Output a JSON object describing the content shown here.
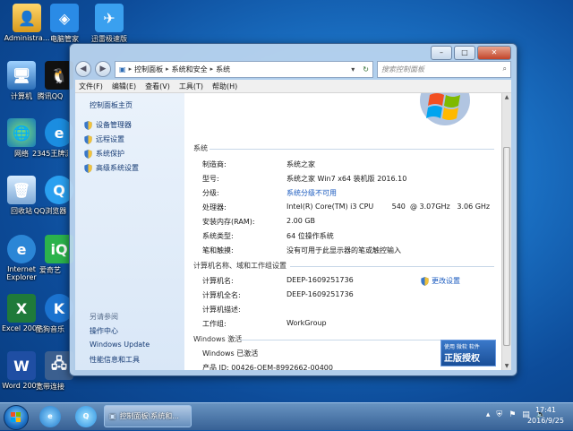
{
  "desktop": {
    "icons": [
      {
        "label": "Administra...",
        "icon": "user-folder-icon"
      },
      {
        "label": "电脑管家",
        "icon": "shield-icon"
      },
      {
        "label": "迅雷极速版",
        "icon": "bird-icon"
      },
      {
        "label": "计算机",
        "icon": "computer-icon"
      },
      {
        "label": "腾讯QQ",
        "icon": "qq-penguin-icon"
      },
      {
        "label": "网络",
        "icon": "network-globe-icon"
      },
      {
        "label": "2345王牌浏览器",
        "icon": "browser-e-icon"
      },
      {
        "label": "回收站",
        "icon": "recycle-bin-icon"
      },
      {
        "label": "QQ浏览器",
        "icon": "qq-browser-icon"
      },
      {
        "label": "Internet Explorer",
        "icon": "ie-icon"
      },
      {
        "label": "爱奇艺",
        "icon": "iqiyi-icon"
      },
      {
        "label": "Excel 2007",
        "icon": "excel-icon"
      },
      {
        "label": "酷狗音乐",
        "icon": "kugou-icon"
      },
      {
        "label": "Word 2007",
        "icon": "word-icon"
      },
      {
        "label": "宽带连接",
        "icon": "broadband-icon"
      }
    ]
  },
  "window": {
    "controls": {
      "minimize": "–",
      "maximize": "□",
      "close": "✕"
    },
    "breadcrumb": [
      "控制面板",
      "系统和安全",
      "系统"
    ],
    "search_placeholder": "搜索控制面板",
    "menu": [
      "文件(F)",
      "编辑(E)",
      "查看(V)",
      "工具(T)",
      "帮助(H)"
    ],
    "left": {
      "home": "控制面板主页",
      "links": [
        "设备管理器",
        "远程设置",
        "系统保护",
        "高级系统设置"
      ],
      "see_also_title": "另请参阅",
      "see_also": [
        "操作中心",
        "Windows Update",
        "性能信息和工具"
      ]
    },
    "system": {
      "title": "系统",
      "rows": [
        {
          "k": "制造商:",
          "v": "系统之家"
        },
        {
          "k": "型号:",
          "v": "系统之家 Win7 x64 装机版 2016.10"
        },
        {
          "k": "分级:",
          "v": "系统分级不可用"
        },
        {
          "k": "处理器:",
          "v": "Intel(R) Core(TM) i3 CPU        540  @ 3.07GHz   3.06 GHz"
        },
        {
          "k": "安装内存(RAM):",
          "v": "2.00 GB"
        },
        {
          "k": "系统类型:",
          "v": "64 位操作系统"
        },
        {
          "k": "笔和触摸:",
          "v": "没有可用于此显示器的笔或触控输入"
        }
      ]
    },
    "computer": {
      "title": "计算机名称、域和工作组设置",
      "change": "更改设置",
      "rows": [
        {
          "k": "计算机名:",
          "v": "DEEP-1609251736"
        },
        {
          "k": "计算机全名:",
          "v": "DEEP-1609251736"
        },
        {
          "k": "计算机描述:",
          "v": ""
        },
        {
          "k": "工作组:",
          "v": "WorkGroup"
        }
      ]
    },
    "activation": {
      "title": "Windows 激活",
      "status": "Windows 已激活",
      "product_id": "产品 ID: 00426-OEM-8992662-00400",
      "badge_top": "使用 微软 软件",
      "badge_main": "正版授权"
    }
  },
  "taskbar": {
    "task_label": "控制面板\\系统和...",
    "time": "17:41",
    "date": "2016/9/25"
  }
}
